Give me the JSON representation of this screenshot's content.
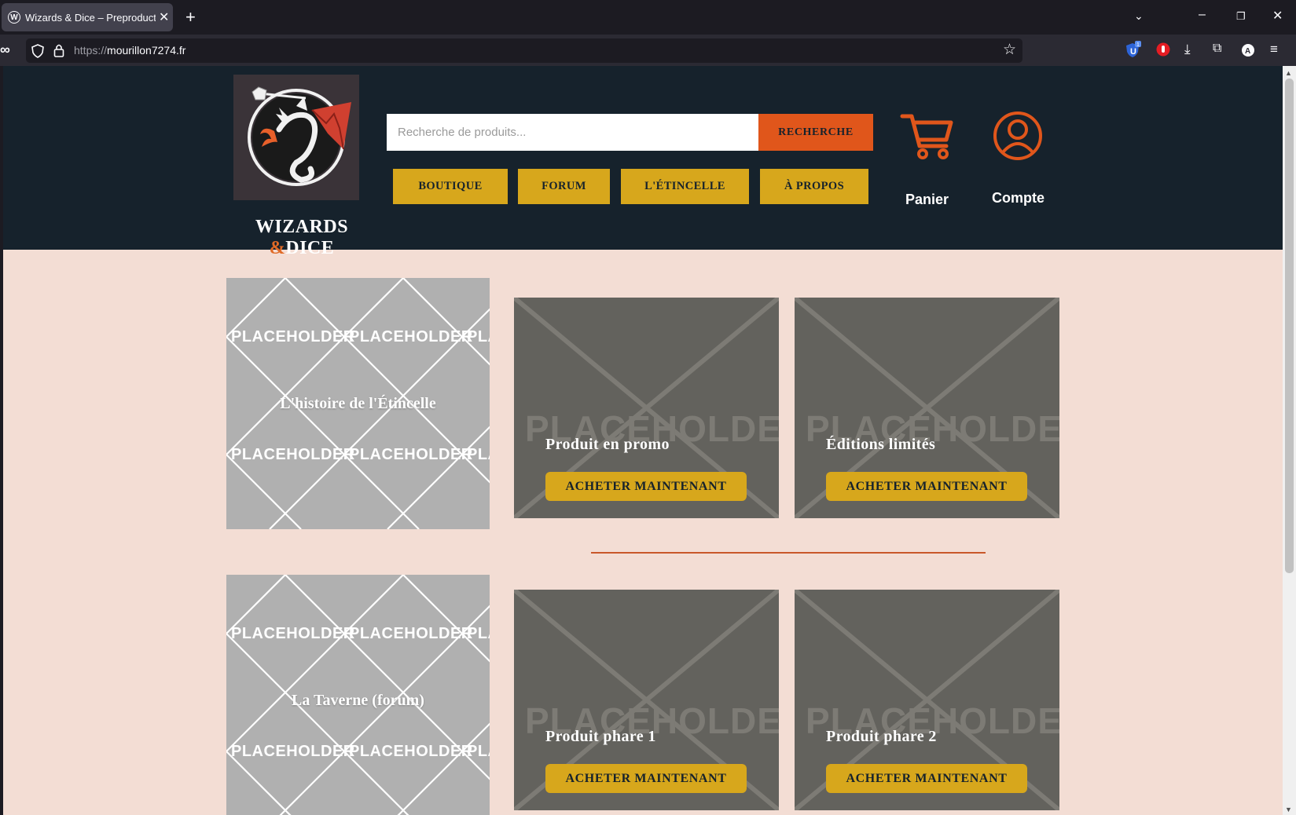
{
  "browser": {
    "tab_title": "Wizards & Dice – Preproduction",
    "tab_icon": "W",
    "url_protocol": "https://",
    "url_host": "mourillon7274.fr",
    "extension_badge": "1"
  },
  "header": {
    "brand_part1": "WIZARDS ",
    "brand_amp": "&",
    "brand_part2": "DICE",
    "search_placeholder": "Recherche de produits...",
    "search_button": "RECHERCHE",
    "nav": [
      "BOUTIQUE",
      "FORUM",
      "L'ÉTINCELLE",
      "À PROPOS"
    ],
    "cart_label": "Panier",
    "account_label": "Compte"
  },
  "placeholder_word": "PLACEHOLDER",
  "sections": [
    {
      "story_title": "L'histoire de l'Étincelle",
      "products": [
        {
          "title": "Produit en promo",
          "button": "ACHETER MAINTENANT"
        },
        {
          "title": "Éditions limités",
          "button": "ACHETER MAINTENANT"
        }
      ]
    },
    {
      "story_title": "La Taverne (forum)",
      "products": [
        {
          "title": "Produit phare 1",
          "button": "ACHETER MAINTENANT"
        },
        {
          "title": "Produit phare 2",
          "button": "ACHETER MAINTENANT"
        }
      ]
    }
  ],
  "colors": {
    "header_bg": "#16222c",
    "page_bg": "#f3ddd4",
    "accent_orange": "#e0561b",
    "nav_gold": "#d7a71c",
    "product_bg": "#63625d"
  }
}
